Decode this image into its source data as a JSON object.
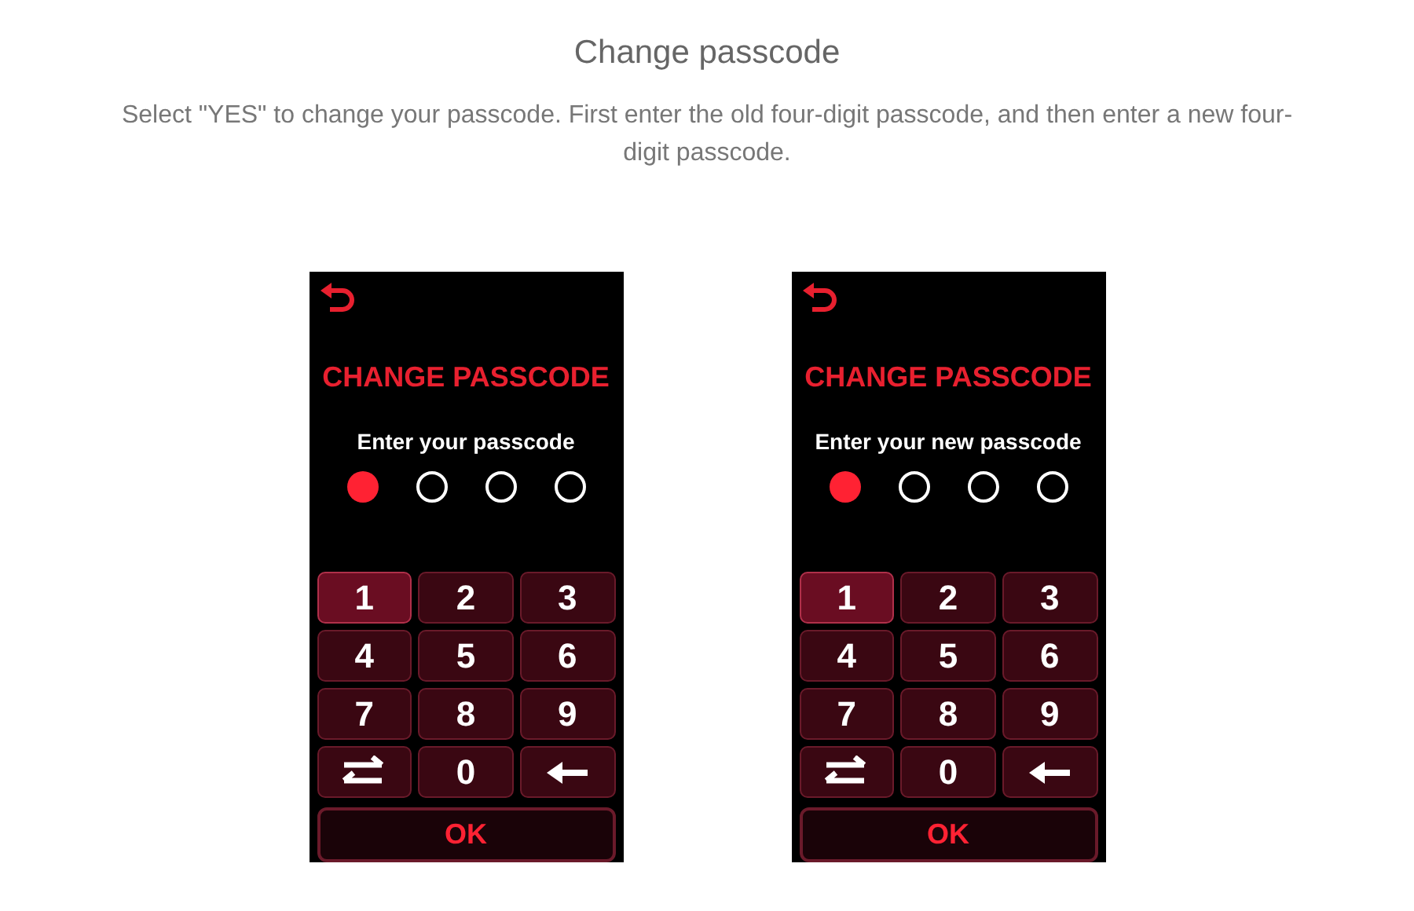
{
  "heading": "Change passcode",
  "description": "Select \"YES\" to change your passcode. First enter the old four-digit passcode, and then enter a new four-digit passcode.",
  "screens": [
    {
      "title": "CHANGE PASSCODE",
      "prompt": "Enter your passcode",
      "dots": [
        {
          "filled": true
        },
        {
          "filled": false
        },
        {
          "filled": false
        },
        {
          "filled": false
        }
      ],
      "keys": [
        {
          "kind": "digit",
          "label": "1",
          "highlighted": true
        },
        {
          "kind": "digit",
          "label": "2",
          "highlighted": false
        },
        {
          "kind": "digit",
          "label": "3",
          "highlighted": false
        },
        {
          "kind": "digit",
          "label": "4",
          "highlighted": false
        },
        {
          "kind": "digit",
          "label": "5",
          "highlighted": false
        },
        {
          "kind": "digit",
          "label": "6",
          "highlighted": false
        },
        {
          "kind": "digit",
          "label": "7",
          "highlighted": false
        },
        {
          "kind": "digit",
          "label": "8",
          "highlighted": false
        },
        {
          "kind": "digit",
          "label": "9",
          "highlighted": false
        },
        {
          "kind": "swap",
          "highlighted": false
        },
        {
          "kind": "digit",
          "label": "0",
          "highlighted": false
        },
        {
          "kind": "backspace",
          "highlighted": false
        }
      ],
      "ok": "OK"
    },
    {
      "title": "CHANGE PASSCODE",
      "prompt": "Enter your new passcode",
      "dots": [
        {
          "filled": true
        },
        {
          "filled": false
        },
        {
          "filled": false
        },
        {
          "filled": false
        }
      ],
      "keys": [
        {
          "kind": "digit",
          "label": "1",
          "highlighted": true
        },
        {
          "kind": "digit",
          "label": "2",
          "highlighted": false
        },
        {
          "kind": "digit",
          "label": "3",
          "highlighted": false
        },
        {
          "kind": "digit",
          "label": "4",
          "highlighted": false
        },
        {
          "kind": "digit",
          "label": "5",
          "highlighted": false
        },
        {
          "kind": "digit",
          "label": "6",
          "highlighted": false
        },
        {
          "kind": "digit",
          "label": "7",
          "highlighted": false
        },
        {
          "kind": "digit",
          "label": "8",
          "highlighted": false
        },
        {
          "kind": "digit",
          "label": "9",
          "highlighted": false
        },
        {
          "kind": "swap",
          "highlighted": false
        },
        {
          "kind": "digit",
          "label": "0",
          "highlighted": false
        },
        {
          "kind": "backspace",
          "highlighted": false
        }
      ],
      "ok": "OK"
    }
  ]
}
